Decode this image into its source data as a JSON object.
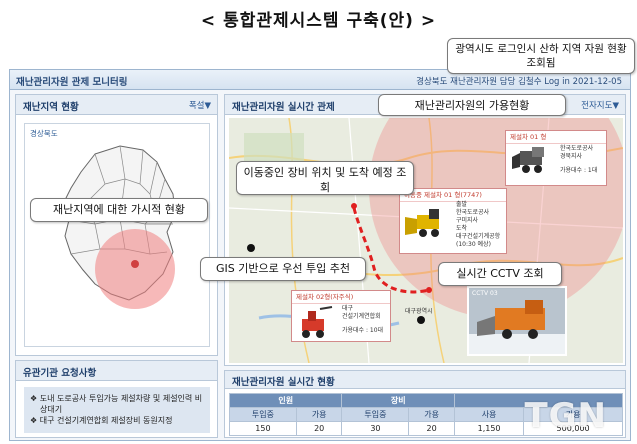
{
  "slide": {
    "title": "< 통합관제시스템 구축(안) >"
  },
  "callouts": {
    "top_right": "광역시도 로그인시 산하 지역 자원 현황 조회됨",
    "operator_status": "재난관리자원의 가용현황",
    "moving_equipment": "이동중인 장비 위치 및 도착 예정 조회",
    "disaster_visual": "재난지역에 대한 가시적 현황",
    "gis_recommend": "GIS 기반으로 우선 투입 추천",
    "cctv": "실시간 CCTV 조회"
  },
  "app": {
    "title": "재난관리자원 관제 모니터링",
    "user_info": "경상북도 재난관리자원 담당 김철수 Log in 2021-12-05"
  },
  "disaster_panel": {
    "title": "재난지역 현황",
    "control": "폭설▼",
    "region_label": "경상북도"
  },
  "map_panel": {
    "title": "재난관리자원 실시간 관제",
    "control": "전자지도▼"
  },
  "cards": {
    "card1": {
      "title": "제설차 01 형",
      "lines": [
        "한국도로공사",
        "경북지사",
        "가용대수 : 1대"
      ]
    },
    "card2": {
      "title": "이동중 제설차 01 형(7747)",
      "lines": [
        "출발",
        "한국도로공사",
        "구미지사",
        "도착",
        "대구건설기계공항",
        "(10:30 예상)"
      ]
    },
    "card3": {
      "title": "제설차 02형(자주식)",
      "lines": [
        "대구",
        "건설기계연합회",
        "가용대수 : 10대"
      ]
    },
    "cctv_label": "CCTV 03",
    "map_place": "대구광역시"
  },
  "request_panel": {
    "title": "유관기관 요청사항",
    "items": [
      "❖ 도내 도로공사 투입가능 제설차량 및 제설인력 비상대기",
      "❖ 대구 건설기계연합회 제설장비 동원지정"
    ]
  },
  "stats_panel": {
    "title": "재난관리자원 실시간 현황",
    "groups": [
      "인원",
      "장비",
      "",
      ""
    ],
    "headers": [
      "투입중",
      "가용",
      "투입중",
      "가용",
      "사용",
      "가용"
    ],
    "values": [
      "150",
      "20",
      "30",
      "20",
      "1,150",
      "500,000"
    ]
  },
  "watermark": "TGN",
  "colors": {
    "accent": "#2a4c7a",
    "header_bg": "#6f8fb8",
    "disaster_zone": "#f08080",
    "route": "#e02020"
  }
}
